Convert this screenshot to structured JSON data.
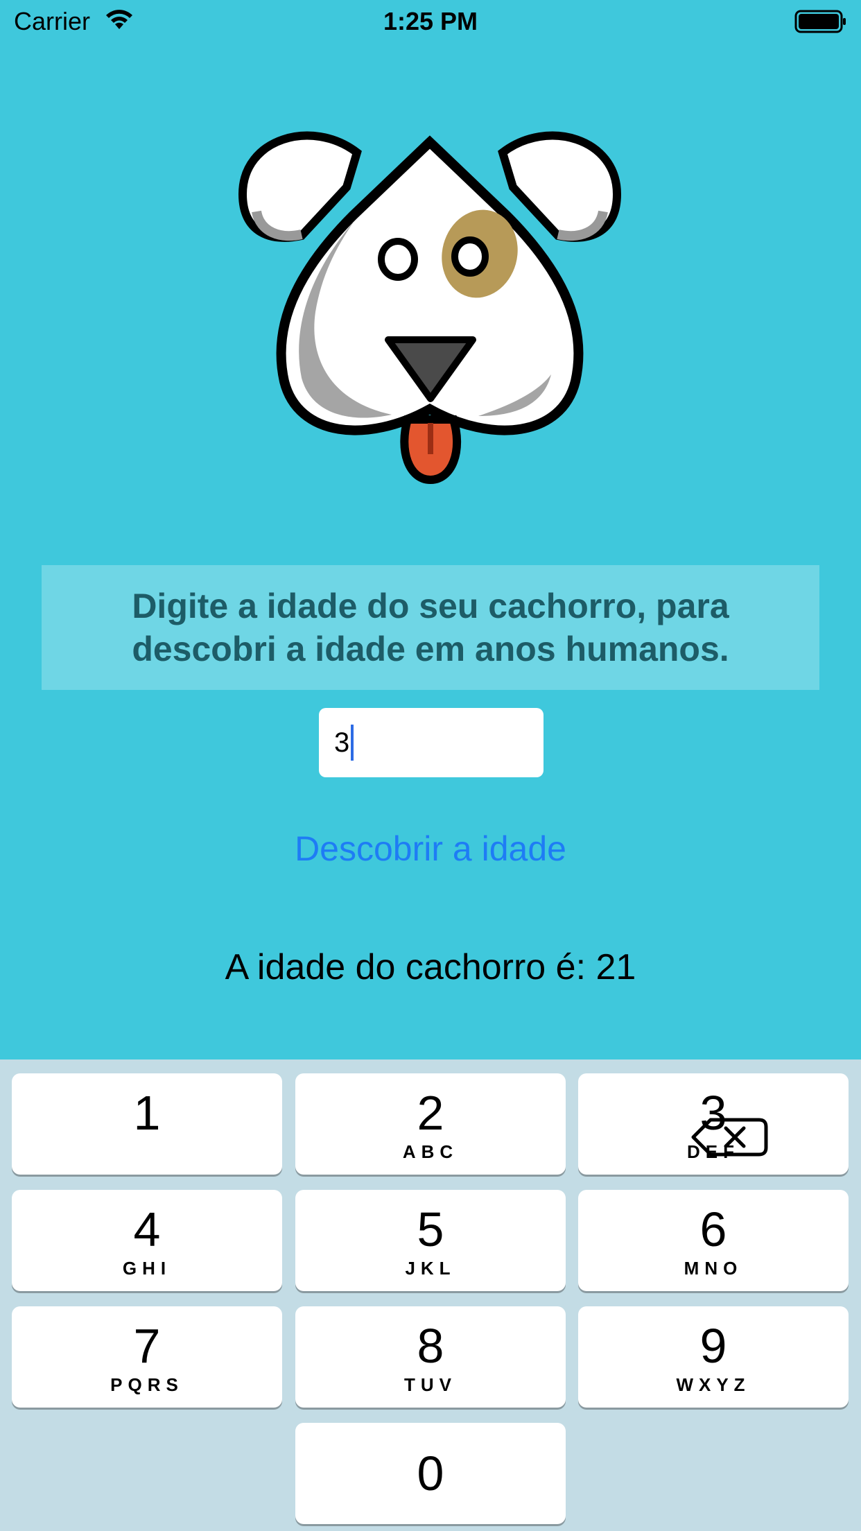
{
  "status_bar": {
    "carrier": "Carrier",
    "time": "1:25 PM",
    "icons": [
      "wifi-icon",
      "battery-icon"
    ]
  },
  "hero": {
    "image": "dog-face-logo"
  },
  "instruction": {
    "text": "Digite a idade do seu cachorro, para descobri a idade em anos humanos."
  },
  "age_input": {
    "value": "3"
  },
  "action_button": {
    "label": "Descobrir a idade"
  },
  "result": {
    "text": "A idade do cachorro é: 21"
  },
  "keyboard": {
    "keys": [
      {
        "digit": "1",
        "letters": ""
      },
      {
        "digit": "2",
        "letters": "ABC"
      },
      {
        "digit": "3",
        "letters": "DEF"
      },
      {
        "digit": "4",
        "letters": "GHI"
      },
      {
        "digit": "5",
        "letters": "JKL"
      },
      {
        "digit": "6",
        "letters": "MNO"
      },
      {
        "digit": "7",
        "letters": "PQRS"
      },
      {
        "digit": "8",
        "letters": "TUV"
      },
      {
        "digit": "9",
        "letters": "WXYZ"
      },
      {
        "digit": "0",
        "letters": ""
      }
    ],
    "delete_icon": "backspace-icon"
  },
  "colors": {
    "background": "#3FC8DC",
    "instruction_text": "#1D5C67",
    "button_text": "#1E7CF5",
    "keyboard_bg": "#C3DCE5"
  }
}
